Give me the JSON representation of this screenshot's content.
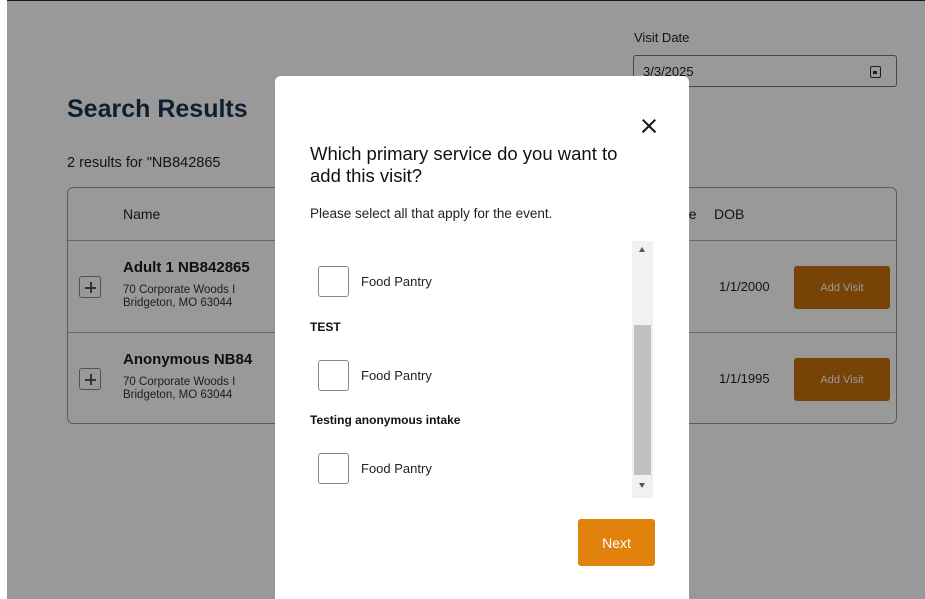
{
  "visit_date": {
    "label": "Visit Date",
    "value": "3/3/2025"
  },
  "search": {
    "title": "Search Results",
    "count_text": "2 results for \"NB842865"
  },
  "table": {
    "headers": {
      "name": "Name",
      "age": "ne",
      "dob": "DOB"
    },
    "rows": [
      {
        "name": "Adult 1 NB842865",
        "address_line1": "70 Corporate Woods I",
        "address_line2": "Bridgeton, MO 63044",
        "dob": "1/1/2000",
        "action": "Add Visit"
      },
      {
        "name": "Anonymous NB84",
        "address_line1": "70 Corporate Woods I",
        "address_line2": "Bridgeton, MO 63044",
        "dob": "1/1/1995",
        "action": "Add Visit"
      }
    ]
  },
  "modal": {
    "title": "Which primary service do you want to add this visit?",
    "subtitle": "Please select all that apply for the event.",
    "options": [
      {
        "label": "Food Pantry",
        "checked": false
      },
      {
        "group": "TEST"
      },
      {
        "label": "Food Pantry",
        "checked": false
      },
      {
        "group": "Testing anonymous intake"
      },
      {
        "label": "Food Pantry",
        "checked": false
      }
    ],
    "next_label": "Next"
  },
  "colors": {
    "accent": "#e0820b",
    "title_navy": "#1a3550",
    "overlay": "rgba(0,0,0,0.40)"
  },
  "icons": [
    "calendar-icon",
    "close-icon",
    "plus-icon",
    "scroll-up-arrow",
    "scroll-down-arrow"
  ]
}
